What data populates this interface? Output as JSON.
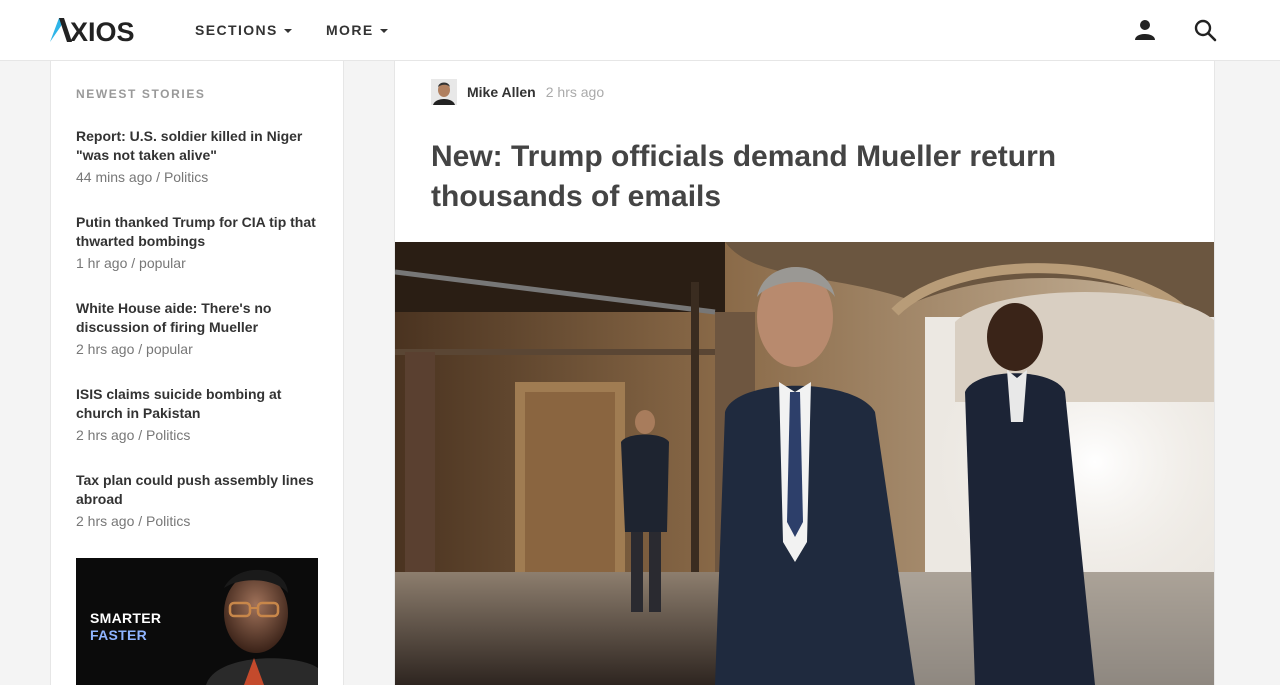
{
  "header": {
    "logo": "AXIOS",
    "nav": [
      {
        "label": "SECTIONS"
      },
      {
        "label": "MORE"
      }
    ],
    "icons": [
      "user-icon",
      "search-icon"
    ]
  },
  "sidebar": {
    "heading": "NEWEST STORIES",
    "stories": [
      {
        "title": "Report: U.S. soldier killed in Niger \"was not taken alive\"",
        "meta": "44 mins ago / Politics"
      },
      {
        "title": "Putin thanked Trump for CIA tip that thwarted bombings",
        "meta": "1 hr ago / popular"
      },
      {
        "title": "White House aide: There's no discussion of firing Mueller",
        "meta": "2 hrs ago / popular"
      },
      {
        "title": "ISIS claims suicide bombing at church in Pakistan",
        "meta": "2 hrs ago / Politics"
      },
      {
        "title": "Tax plan could push assembly lines abroad",
        "meta": "2 hrs ago / Politics"
      }
    ],
    "promo": {
      "line1": "SMARTER",
      "line2": "FASTER"
    }
  },
  "article": {
    "author": "Mike Allen",
    "time": "2 hrs ago",
    "headline": "New: Trump officials demand Mueller return thousands of emails"
  },
  "colors": {
    "brand_blue": "#2fb5e8",
    "text_dark": "#333333",
    "text_muted": "#999999",
    "promo_accent": "#8fb4ff"
  }
}
